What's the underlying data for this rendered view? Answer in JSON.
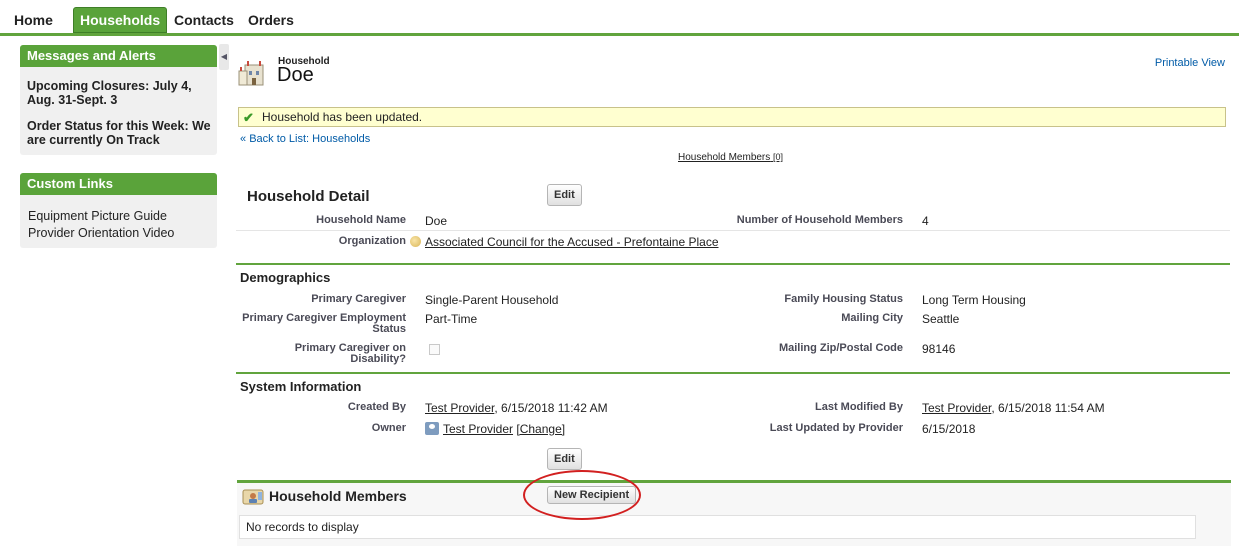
{
  "tabs": [
    "Home",
    "Households",
    "Contacts",
    "Orders"
  ],
  "sidebar": {
    "messages_title": "Messages and Alerts",
    "alert_1": "Upcoming Closures: July 4, Aug. 31-Sept. 3",
    "alert_2": "Order Status for this Week: We are currently On Track",
    "links_title": "Custom Links",
    "links": [
      "Equipment Picture Guide",
      "Provider Orientation Video"
    ]
  },
  "header": {
    "object_type": "Household",
    "record_name": "Doe",
    "printable_view": "Printable View"
  },
  "message": "Household has been updated.",
  "back_prefix": "« ",
  "back_link": "Back to List: Households",
  "related_link": "Household Members",
  "related_count": "[0]",
  "detail": {
    "title": "Household Detail",
    "edit_label": "Edit",
    "household_name_label": "Household Name",
    "household_name": "Doe",
    "num_members_label": "Number of Household Members",
    "num_members": "4",
    "organization_label": "Organization",
    "organization": "Associated Council for the Accused - Prefontaine Place"
  },
  "demographics": {
    "title": "Demographics",
    "primary_caregiver_label": "Primary Caregiver",
    "primary_caregiver": "Single-Parent Household",
    "family_housing_label": "Family Housing Status",
    "family_housing": "Long Term Housing",
    "employment_label_1": "Primary Caregiver Employment",
    "employment_label_2": "Status",
    "employment": "Part-Time",
    "mailing_city_label": "Mailing City",
    "mailing_city": "Seattle",
    "disability_label": "Primary Caregiver on Disability?",
    "disability_checked": false,
    "zip_label": "Mailing Zip/Postal Code",
    "zip": "98146"
  },
  "system": {
    "title": "System Information",
    "created_by_label": "Created By",
    "created_by_user": "Test Provider",
    "created_by_date": ", 6/15/2018 11:42 AM",
    "last_modified_label": "Last Modified By",
    "last_modified_user": "Test Provider",
    "last_modified_date": ", 6/15/2018 11:54 AM",
    "owner_label": "Owner",
    "owner": "Test Provider",
    "change_link": "[Change]",
    "last_updated_label": "Last Updated by Provider",
    "last_updated": "6/15/2018",
    "edit_label": "Edit"
  },
  "members_list": {
    "title": "Household Members",
    "new_button": "New Recipient",
    "empty": "No records to display"
  },
  "colors": {
    "accent_green": "#5aa33a",
    "link_blue": "#015ba7",
    "message_bg": "#ffffd0",
    "annotation_red": "#d22020"
  }
}
